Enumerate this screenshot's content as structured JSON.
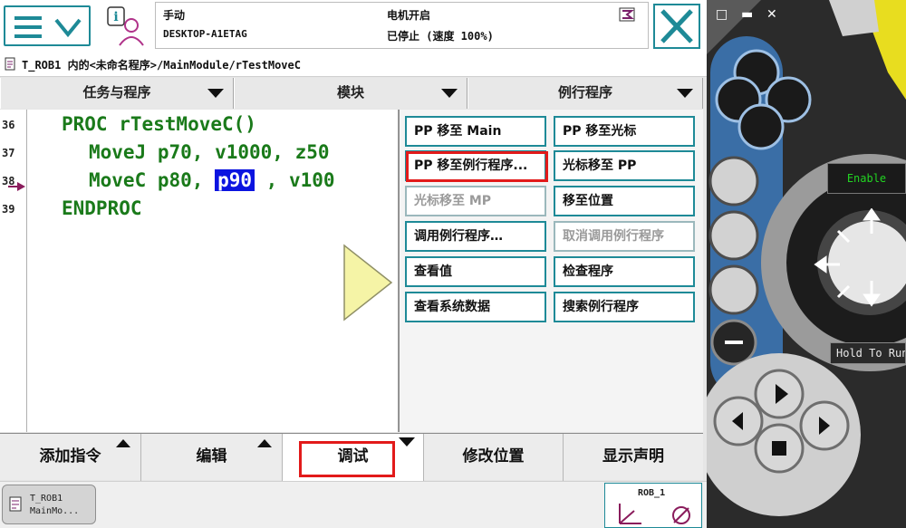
{
  "status": {
    "mode": "手动",
    "system_name": "DESKTOP-A1ETAG",
    "motors": "电机开启",
    "state": "已停止 (速度 100%)"
  },
  "path": "T_ROB1 内的<未命名程序>/MainModule/rTestMoveC",
  "tabs": [
    {
      "label": "任务与程序"
    },
    {
      "label": "模块"
    },
    {
      "label": "例行程序"
    }
  ],
  "code": {
    "line_numbers": [
      "36",
      "37",
      "38",
      "39"
    ],
    "line36": "PROC rTestMoveC()",
    "line37": "MoveJ p70, v1000, z50",
    "line38_a": "MoveC p80, ",
    "line38_sel": "p90",
    "line38_b": " , v100",
    "line39": "ENDPROC"
  },
  "debug_menu": {
    "pp_to_main": "PP 移至 Main",
    "pp_to_cursor": "PP 移至光标",
    "pp_to_routine": "PP 移至例行程序...",
    "cursor_to_pp": "光标移至 PP",
    "cursor_to_mp": "光标移至 MP",
    "goto_position": "移至位置",
    "call_routine": "调用例行程序…",
    "cancel_call_routine": "取消调用例行程序",
    "view_value": "查看值",
    "check_program": "检查程序",
    "view_system_data": "查看系统数据",
    "search_routine": "搜索例行程序"
  },
  "bottom_tabs": {
    "add_instruction": "添加指令",
    "edit": "编辑",
    "debug": "调试",
    "modify_position": "修改位置",
    "show_declarations": "显示声明"
  },
  "taskbar": {
    "task_line1": "T_ROB1",
    "task_line2": "MainMo...",
    "robot": "ROB_1"
  },
  "pendant": {
    "enable": "Enable",
    "hold_to_run": "Hold To Run"
  },
  "colors": {
    "accent": "#1e8a97",
    "highlight_red": "#e21a1a",
    "code_green": "#1a7a1a",
    "selection_blue": "#0b14e0"
  }
}
